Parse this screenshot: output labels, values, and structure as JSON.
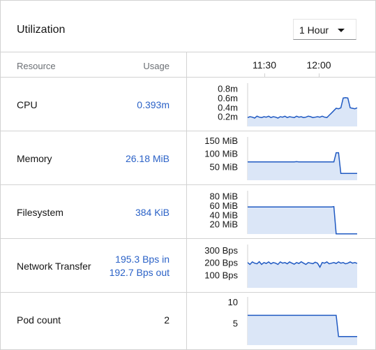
{
  "header": {
    "title": "Utilization",
    "timespan": "1 Hour"
  },
  "table": {
    "col_resource": "Resource",
    "col_usage": "Usage",
    "time_ticks": [
      "11:30",
      "12:00"
    ]
  },
  "rows": [
    {
      "name": "CPU",
      "value": "0.393m"
    },
    {
      "name": "Memory",
      "value": "26.18 MiB"
    },
    {
      "name": "Filesystem",
      "value": "384 KiB"
    },
    {
      "name": "Network Transfer",
      "value_in": "195.3 Bps in",
      "value_out": "192.7 Bps out"
    },
    {
      "name": "Pod count",
      "value": "2"
    }
  ],
  "colors": {
    "line": "#1f59c2",
    "fill": "#dbe6f7",
    "value_text": "#2b62c7"
  },
  "chart_data": [
    {
      "type": "area",
      "name": "CPU",
      "yticks": [
        "0.8m",
        "0.6m",
        "0.4m",
        "0.2m"
      ],
      "ytick_values": [
        0.8,
        0.6,
        0.4,
        0.2
      ],
      "ylim": [
        0,
        0.9
      ],
      "values": [
        0.19,
        0.21,
        0.2,
        0.18,
        0.22,
        0.2,
        0.19,
        0.21,
        0.2,
        0.22,
        0.19,
        0.21,
        0.2,
        0.18,
        0.21,
        0.2,
        0.22,
        0.19,
        0.21,
        0.2,
        0.19,
        0.22,
        0.2,
        0.21,
        0.19,
        0.2,
        0.22,
        0.21,
        0.19,
        0.2,
        0.21,
        0.2,
        0.22,
        0.2,
        0.19,
        0.24,
        0.29,
        0.34,
        0.39,
        0.38,
        0.4,
        0.61,
        0.62,
        0.61,
        0.4,
        0.39,
        0.38,
        0.4
      ]
    },
    {
      "type": "area",
      "name": "Memory",
      "yticks": [
        "150 MiB",
        "100 MiB",
        "50 MiB"
      ],
      "ytick_values": [
        150,
        100,
        50
      ],
      "ylim": [
        0,
        160
      ],
      "values": [
        70,
        70,
        70,
        70,
        70,
        70,
        70,
        70,
        70,
        70,
        70,
        70,
        70,
        70,
        70,
        70,
        70,
        70,
        70,
        70,
        70,
        71,
        70,
        70,
        70,
        70,
        70,
        70,
        70,
        70,
        70,
        70,
        70,
        70,
        70,
        70,
        70,
        70,
        105,
        105,
        26,
        26,
        26,
        26,
        26,
        26,
        26,
        26
      ]
    },
    {
      "type": "area",
      "name": "Filesystem",
      "yticks": [
        "80 MiB",
        "60 MiB",
        "40 MiB",
        "20 MiB"
      ],
      "ytick_values": [
        80,
        60,
        40,
        20
      ],
      "ylim": [
        0,
        90
      ],
      "values": [
        58,
        58,
        58,
        58,
        58,
        58,
        58,
        58,
        58,
        58,
        58,
        58,
        58,
        58,
        58,
        58,
        58,
        58,
        58,
        58,
        58,
        58,
        58,
        58,
        58,
        58,
        58,
        58,
        58,
        58,
        58,
        58,
        58,
        58,
        58,
        58,
        58,
        59,
        0.4,
        0.4,
        0.4,
        0.4,
        0.4,
        0.4,
        0.4,
        0.4,
        0.4,
        0.4
      ]
    },
    {
      "type": "area",
      "name": "Network Transfer",
      "yticks": [
        "300 Bps",
        "200 Bps",
        "100 Bps"
      ],
      "ytick_values": [
        300,
        200,
        100
      ],
      "ylim": [
        0,
        340
      ],
      "values": [
        205,
        190,
        210,
        200,
        195,
        212,
        190,
        205,
        198,
        210,
        195,
        205,
        200,
        190,
        210,
        200,
        205,
        195,
        210,
        200,
        192,
        205,
        198,
        212,
        200,
        190,
        205,
        200,
        196,
        208,
        200,
        168,
        205,
        200,
        210,
        195,
        200,
        205,
        198,
        210,
        200,
        205,
        195,
        200,
        210,
        200,
        205,
        198
      ]
    },
    {
      "type": "area",
      "name": "Pod count",
      "yticks": [
        "10",
        "5"
      ],
      "ytick_values": [
        10,
        5
      ],
      "ylim": [
        0,
        11
      ],
      "values": [
        7,
        7,
        7,
        7,
        7,
        7,
        7,
        7,
        7,
        7,
        7,
        7,
        7,
        7,
        7,
        7,
        7,
        7,
        7,
        7,
        7,
        7,
        7,
        7,
        7,
        7,
        7,
        7,
        7,
        7,
        7,
        7,
        7,
        7,
        7,
        7,
        7,
        7,
        7,
        2,
        2,
        2,
        2,
        2,
        2,
        2,
        2,
        2
      ]
    }
  ]
}
